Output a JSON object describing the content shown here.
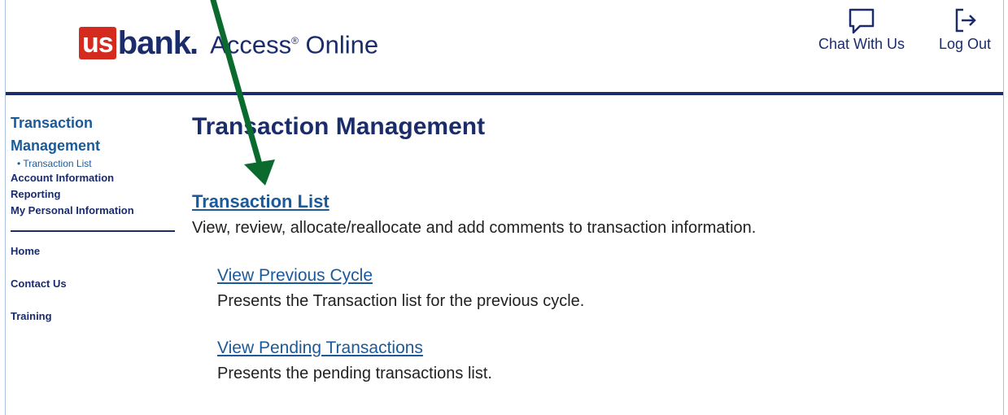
{
  "header": {
    "logo_us": "us",
    "logo_bank": "bank",
    "logo_dot": ".",
    "product": "Access",
    "product_reg": "®",
    "product_rest": " Online",
    "chat_label": "Chat With Us",
    "logout_label": "Log Out"
  },
  "sidebar": {
    "title": "Transaction Management",
    "sub_item": "• Transaction List",
    "links": [
      "Account Information",
      "Reporting",
      "My Personal Information"
    ],
    "bottom_links": [
      "Home",
      "Contact Us",
      "Training"
    ]
  },
  "main": {
    "title": "Transaction Management",
    "section_link": "Transaction List",
    "section_desc": "View, review, allocate/reallocate and add comments to transaction information.",
    "items": [
      {
        "link": "View Previous Cycle",
        "desc": "Presents the Transaction list for the previous cycle."
      },
      {
        "link": "View Pending Transactions",
        "desc": "Presents the pending transactions list."
      }
    ]
  },
  "colors": {
    "brand_navy": "#1b2c6b",
    "link_blue": "#1b5a9a",
    "brand_red": "#d52b1e",
    "annotation_green": "#0b6b2e"
  },
  "icons": {
    "chat": "chat-bubble-icon",
    "logout": "logout-icon",
    "annotation": "arrow-annotation-icon"
  }
}
